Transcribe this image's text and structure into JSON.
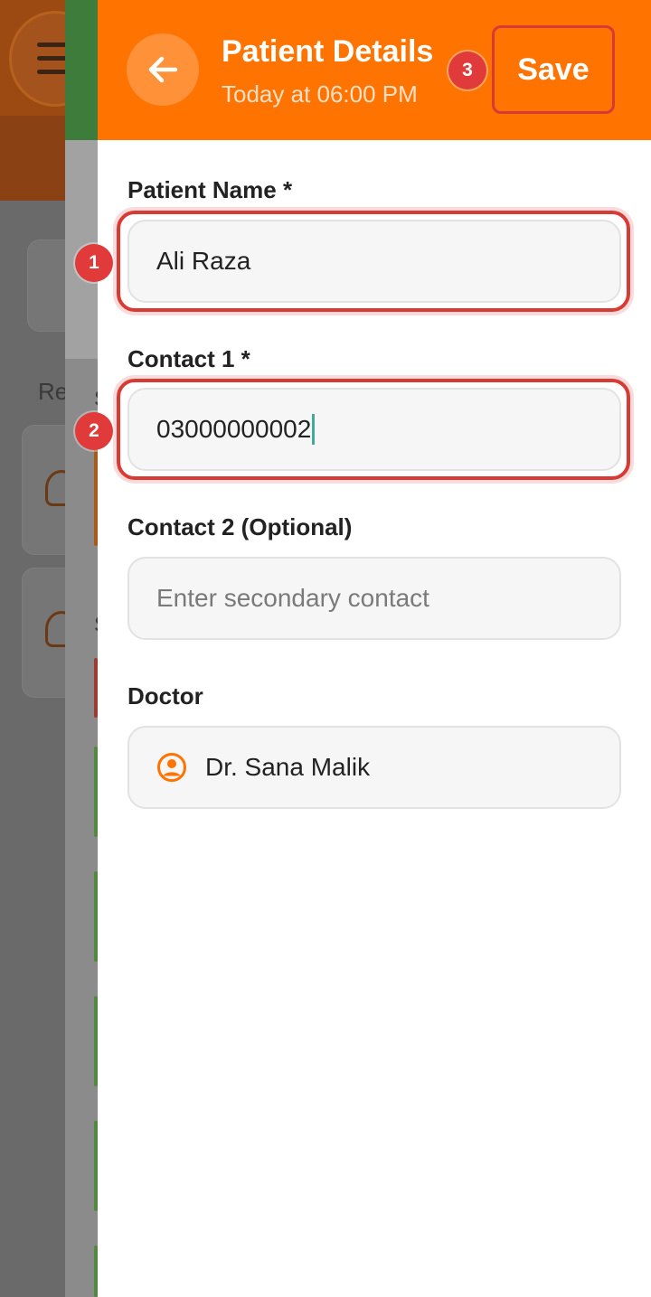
{
  "header": {
    "title": "Patient Details",
    "subtitle": "Today at 06:00 PM",
    "save_label": "Save"
  },
  "markers": [
    "1",
    "2",
    "3"
  ],
  "form": {
    "patient_name": {
      "label": "Patient Name *",
      "value": "Ali Raza"
    },
    "contact1": {
      "label": "Contact 1 *",
      "value": "03000000002"
    },
    "contact2": {
      "label": "Contact 2 (Optional)",
      "placeholder": "Enter secondary contact"
    },
    "doctor": {
      "label": "Doctor",
      "value": "Dr. Sana Malik"
    }
  },
  "background": {
    "partial_texts": [
      "Re",
      "S",
      "S"
    ]
  },
  "colors": {
    "accent": "#ff7300",
    "highlight": "#d83a34",
    "marker": "#e03a3a"
  },
  "icons": {
    "back": "arrow-left-icon",
    "menu": "hamburger-icon",
    "doctor": "user-circle-icon"
  }
}
